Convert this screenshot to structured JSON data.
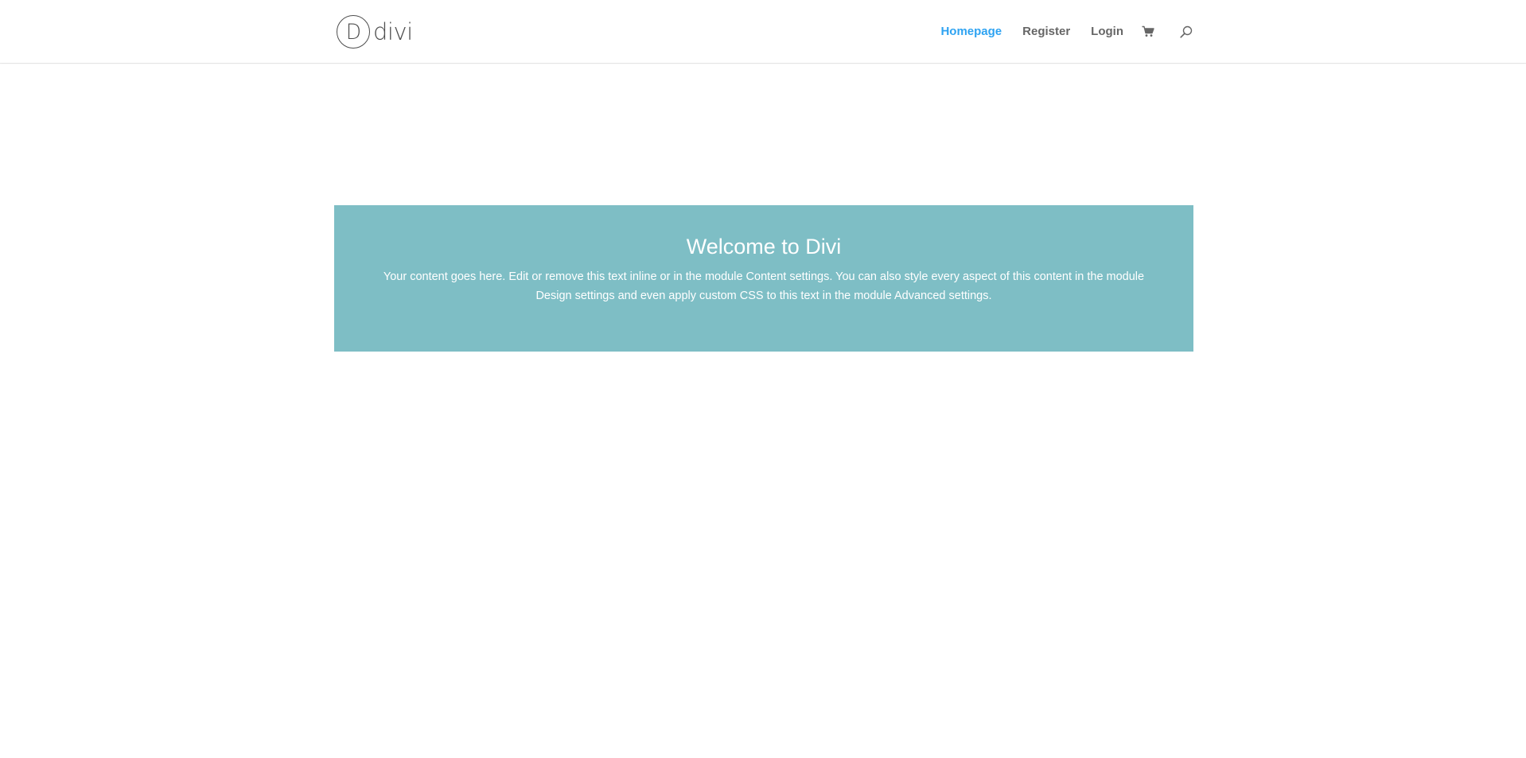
{
  "header": {
    "logo": {
      "letter": "D",
      "wordmark": "divi"
    },
    "nav": {
      "items": [
        {
          "label": "Homepage",
          "active": true
        },
        {
          "label": "Register",
          "active": false
        },
        {
          "label": "Login",
          "active": false
        }
      ],
      "cart_icon": "shopping-cart-icon",
      "search_icon": "magnifier-icon"
    }
  },
  "cta": {
    "title": "Welcome to Divi",
    "text": "Your content goes here. Edit or remove this text inline or in the module Content settings. You can also style every aspect of this content in the module Design settings and even apply custom CSS to this text in the module Advanced settings."
  },
  "colors": {
    "accent": "#2ea3f2",
    "nav_text": "#666666",
    "cta_background": "#7ebec5",
    "cta_text": "#ffffff",
    "logo": "#4d4d4d"
  }
}
